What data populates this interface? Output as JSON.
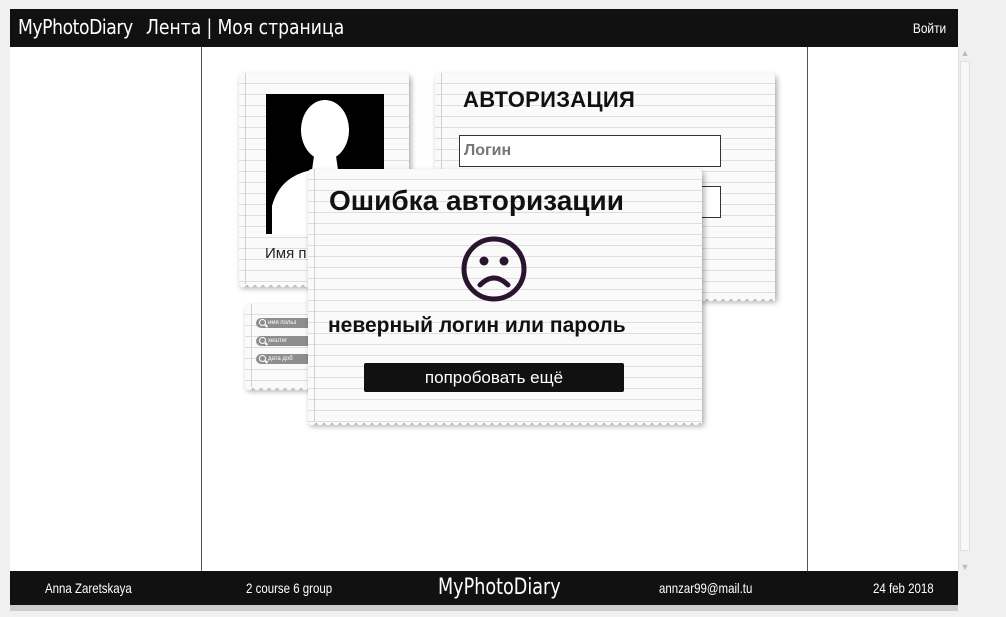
{
  "header": {
    "brand": "MyPhotoDiary",
    "nav": {
      "feed": "Лента",
      "separator": "|",
      "my_page": "Моя страница"
    },
    "login_link": "Войти"
  },
  "profile_card": {
    "name_label": "Имя п"
  },
  "auth": {
    "title": "АВТОРИЗАЦИЯ",
    "login_placeholder": "Логин",
    "password_placeholder": ""
  },
  "search": {
    "chips": [
      {
        "label": "имя польз"
      },
      {
        "label": "хештег"
      },
      {
        "label": "дата доб"
      }
    ]
  },
  "error_dialog": {
    "title": "Ошибка авторизации",
    "icon": "sad-face-icon",
    "message": "неверный логин или пароль",
    "retry_button": "попробовать ещё"
  },
  "footer": {
    "author": "Anna Zaretskaya",
    "group": "2 course 6 group",
    "brand": "MyPhotoDiary",
    "email": "annzar99@mail.tu",
    "date": "24 feb 2018"
  },
  "colors": {
    "bar": "#111111",
    "accent_dark": "#2a1530",
    "paper": "#fafafa"
  }
}
